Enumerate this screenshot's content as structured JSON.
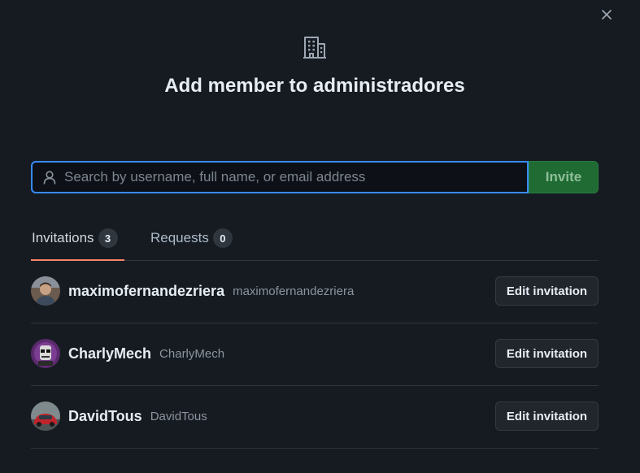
{
  "dialog": {
    "title": "Add member to administradores",
    "icon": "organization-icon",
    "close_icon": "close-icon"
  },
  "search": {
    "placeholder": "Search by username, full name, or email address",
    "value": "",
    "icon": "person-icon"
  },
  "invite_button": {
    "label": "Invite"
  },
  "tabs": [
    {
      "label": "Invitations",
      "count": "3",
      "selected": true
    },
    {
      "label": "Requests",
      "count": "0",
      "selected": false
    }
  ],
  "invitations": [
    {
      "name": "maximofernandezriera",
      "login": "maximofernandezriera",
      "action": "Edit invitation"
    },
    {
      "name": "CharlyMech",
      "login": "CharlyMech",
      "action": "Edit invitation"
    },
    {
      "name": "DavidTous",
      "login": "DavidTous",
      "action": "Edit invitation"
    }
  ],
  "colors": {
    "background": "#161b22",
    "accent_blue": "#388bfd",
    "invite_green": "#1f6b33",
    "tab_underline": "#f78166"
  }
}
